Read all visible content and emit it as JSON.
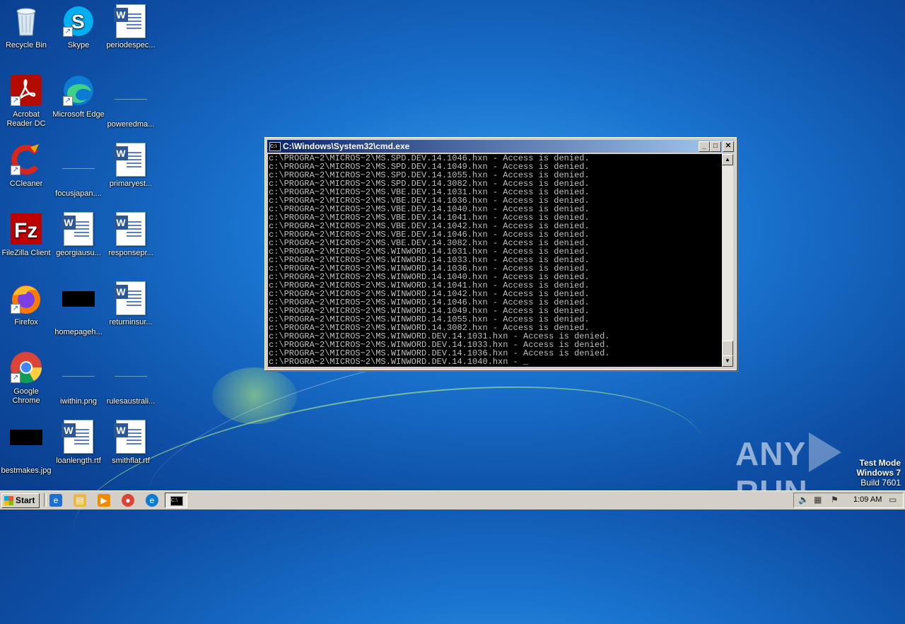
{
  "desktop": {
    "icons": [
      {
        "label": "Recycle Bin"
      },
      {
        "label": "Skype"
      },
      {
        "label": "periodespec..."
      },
      {
        "label": "Acrobat Reader DC"
      },
      {
        "label": "Microsoft Edge"
      },
      {
        "label": "poweredma..."
      },
      {
        "label": "CCleaner"
      },
      {
        "label": "focusjapan...."
      },
      {
        "label": "primaryest..."
      },
      {
        "label": "FileZilla Client"
      },
      {
        "label": "georgiausu..."
      },
      {
        "label": "responsepr..."
      },
      {
        "label": "Firefox"
      },
      {
        "label": "homepageh..."
      },
      {
        "label": "returninsur..."
      },
      {
        "label": "Google Chrome"
      },
      {
        "label": "iwithin.png"
      },
      {
        "label": "rulesaustrali..."
      },
      {
        "label": "bestmakes.jpg"
      },
      {
        "label": "loanlength.rtf"
      },
      {
        "label": "smithflat.rtf"
      }
    ]
  },
  "cmd": {
    "title": "C:\\Windows\\System32\\cmd.exe",
    "icon_text": "C:\\",
    "minimize": "_",
    "maximize": "□",
    "close": "✕",
    "scroll_up": "▲",
    "scroll_down": "▼",
    "lines": [
      "c:\\PROGRA~2\\MICROS~2\\MS.SPD.DEV.14.1046.hxn - Access is denied.",
      "c:\\PROGRA~2\\MICROS~2\\MS.SPD.DEV.14.1049.hxn - Access is denied.",
      "c:\\PROGRA~2\\MICROS~2\\MS.SPD.DEV.14.1055.hxn - Access is denied.",
      "c:\\PROGRA~2\\MICROS~2\\MS.SPD.DEV.14.3082.hxn - Access is denied.",
      "c:\\PROGRA~2\\MICROS~2\\MS.VBE.DEV.14.1031.hxn - Access is denied.",
      "c:\\PROGRA~2\\MICROS~2\\MS.VBE.DEV.14.1036.hxn - Access is denied.",
      "c:\\PROGRA~2\\MICROS~2\\MS.VBE.DEV.14.1040.hxn - Access is denied.",
      "c:\\PROGRA~2\\MICROS~2\\MS.VBE.DEV.14.1041.hxn - Access is denied.",
      "c:\\PROGRA~2\\MICROS~2\\MS.VBE.DEV.14.1042.hxn - Access is denied.",
      "c:\\PROGRA~2\\MICROS~2\\MS.VBE.DEV.14.1046.hxn - Access is denied.",
      "c:\\PROGRA~2\\MICROS~2\\MS.VBE.DEV.14.3082.hxn - Access is denied.",
      "c:\\PROGRA~2\\MICROS~2\\MS.WINWORD.14.1031.hxn - Access is denied.",
      "c:\\PROGRA~2\\MICROS~2\\MS.WINWORD.14.1033.hxn - Access is denied.",
      "c:\\PROGRA~2\\MICROS~2\\MS.WINWORD.14.1036.hxn - Access is denied.",
      "c:\\PROGRA~2\\MICROS~2\\MS.WINWORD.14.1040.hxn - Access is denied.",
      "c:\\PROGRA~2\\MICROS~2\\MS.WINWORD.14.1041.hxn - Access is denied.",
      "c:\\PROGRA~2\\MICROS~2\\MS.WINWORD.14.1042.hxn - Access is denied.",
      "c:\\PROGRA~2\\MICROS~2\\MS.WINWORD.14.1046.hxn - Access is denied.",
      "c:\\PROGRA~2\\MICROS~2\\MS.WINWORD.14.1049.hxn - Access is denied.",
      "c:\\PROGRA~2\\MICROS~2\\MS.WINWORD.14.1055.hxn - Access is denied.",
      "c:\\PROGRA~2\\MICROS~2\\MS.WINWORD.14.3082.hxn - Access is denied.",
      "c:\\PROGRA~2\\MICROS~2\\MS.WINWORD.DEV.14.1031.hxn - Access is denied.",
      "c:\\PROGRA~2\\MICROS~2\\MS.WINWORD.DEV.14.1033.hxn - Access is denied.",
      "c:\\PROGRA~2\\MICROS~2\\MS.WINWORD.DEV.14.1036.hxn - Access is denied.",
      "c:\\PROGRA~2\\MICROS~2\\MS.WINWORD.DEV.14.1040.hxn - "
    ]
  },
  "watermark": {
    "any": "ANY",
    "run": "RUN",
    "test_mode": "Test Mode",
    "os": "Windows 7",
    "build": "Build 7601"
  },
  "taskbar": {
    "start_label": "Start",
    "task_icon_text": "C:\\",
    "clock": "1:09 AM"
  },
  "colors": {
    "terminal_bg": "#000000",
    "terminal_text": "#c0c0c0",
    "titlebar_start": "#0a246a",
    "titlebar_end": "#a6caf0"
  }
}
